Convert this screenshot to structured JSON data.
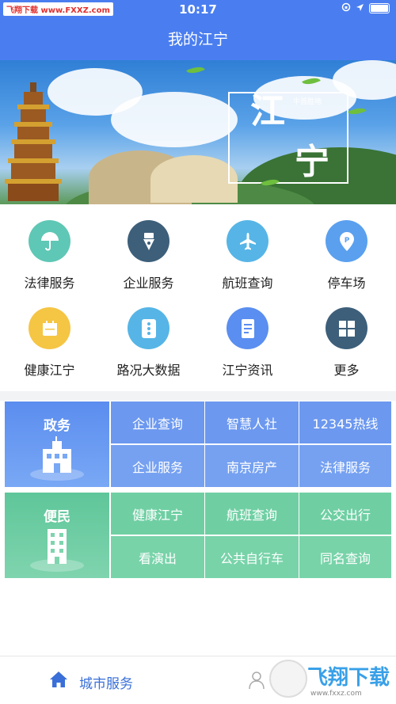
{
  "status_bar": {
    "carrier_badge": "飞翔下载 www.FXXZ.com",
    "time": "10:17"
  },
  "nav": {
    "title": "我的江宁"
  },
  "banner": {
    "char_1": "江",
    "char_2": "宁",
    "small_text": "牛首胜地"
  },
  "services": [
    {
      "label": "法律服务",
      "icon": "umbrella-icon",
      "color": "#5fc7b5"
    },
    {
      "label": "企业服务",
      "icon": "pen-nib-icon",
      "color": "#3d5f7a"
    },
    {
      "label": "航班查询",
      "icon": "airplane-icon",
      "color": "#56b5e6"
    },
    {
      "label": "停车场",
      "icon": "location-pin-icon",
      "color": "#5aa0ef"
    },
    {
      "label": "健康江宁",
      "icon": "calendar-icon",
      "color": "#f5c544"
    },
    {
      "label": "路况大数据",
      "icon": "dots-icon",
      "color": "#56b5e6"
    },
    {
      "label": "江宁资讯",
      "icon": "document-icon",
      "color": "#5a8ef0"
    },
    {
      "label": "更多",
      "icon": "grid-icon",
      "color": "#3d5f7a"
    }
  ],
  "gov_panel": {
    "title": "政务",
    "items": [
      "企业查询",
      "智慧人社",
      "12345热线",
      "企业服务",
      "南京房产",
      "法律服务"
    ]
  },
  "people_panel": {
    "title": "便民",
    "items": [
      "健康江宁",
      "航班查询",
      "公交出行",
      "看演出",
      "公共自行车",
      "同名查询"
    ]
  },
  "tabbar": {
    "home_label": "城市服务"
  },
  "watermark": {
    "text": "飞翔下载",
    "url": "www.fxxz.com"
  },
  "colors": {
    "primary": "#4a7ef0",
    "gov_panel": "#5b8def",
    "people_panel": "#5fc69a"
  }
}
